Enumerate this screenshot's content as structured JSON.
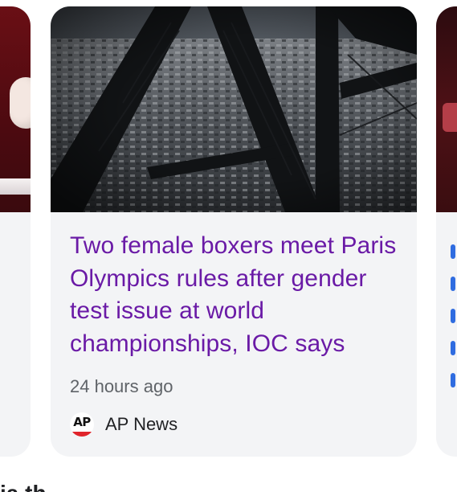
{
  "card_main": {
    "headline": "Two female boxers meet Paris Olympics rules after gender test issue at world championships, IOC says",
    "time": "24 hours ago",
    "source": "AP News",
    "source_logo_text": "AP"
  },
  "below_section": {
    "title_fragment": "ia th"
  },
  "colors": {
    "card_bg": "#f3f4f6",
    "headline": "#6a1aa6",
    "meta": "#5f6368",
    "source_text": "#202124",
    "accent": "#2f6ce0"
  },
  "icons": [
    "ap-news-logo-icon"
  ]
}
